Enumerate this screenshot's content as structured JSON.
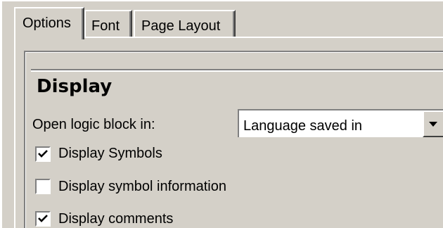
{
  "tabs": [
    {
      "label": "Options",
      "selected": true
    },
    {
      "label": "Font",
      "selected": false
    },
    {
      "label": "Page Layout",
      "selected": false
    }
  ],
  "display": {
    "title": "Display",
    "open_logic_block_label": "Open logic block in:",
    "open_logic_block_value": "Language saved in",
    "options": [
      {
        "label": "Display Symbols",
        "checked": true
      },
      {
        "label": "Display symbol information",
        "checked": false
      },
      {
        "label": "Display comments",
        "checked": true
      }
    ]
  },
  "icons": {
    "dropdown": "chevron-down-icon",
    "checkmark": "checkmark-icon"
  }
}
